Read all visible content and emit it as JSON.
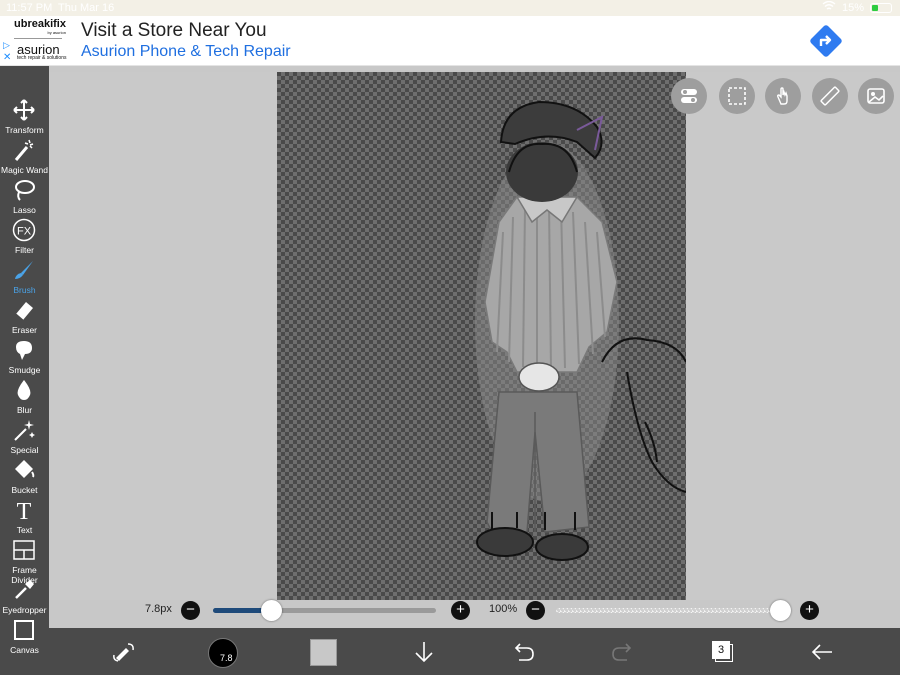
{
  "status": {
    "time": "11:57 PM",
    "date": "Thu Mar 16",
    "battery": "15%"
  },
  "ad": {
    "brand_primary": "ubreakifix",
    "brand_primary_sub": "by asurion",
    "brand_secondary": "asurion",
    "brand_secondary_sub": "tech repair & solutions",
    "headline": "Visit a Store Near You",
    "subline": "Asurion Phone & Tech Repair",
    "icon": "directions-icon",
    "color": "#1f6fe0"
  },
  "tools": [
    {
      "label": "Transform",
      "icon": "move-arrows-icon"
    },
    {
      "label": "Magic Wand",
      "icon": "magic-wand-icon"
    },
    {
      "label": "Lasso",
      "icon": "lasso-icon"
    },
    {
      "label": "Filter",
      "icon": "fx-icon"
    },
    {
      "label": "Brush",
      "icon": "brush-icon",
      "active": true
    },
    {
      "label": "Eraser",
      "icon": "eraser-icon"
    },
    {
      "label": "Smudge",
      "icon": "smudge-icon"
    },
    {
      "label": "Blur",
      "icon": "drop-icon"
    },
    {
      "label": "Special",
      "icon": "sparkle-wand-icon"
    },
    {
      "label": "Bucket",
      "icon": "bucket-icon"
    },
    {
      "label": "Text",
      "icon": "text-icon"
    },
    {
      "label": "Frame Divider",
      "icon": "frame-divider-icon"
    },
    {
      "label": "Eyedropper",
      "icon": "eyedropper-icon"
    },
    {
      "label": "Canvas",
      "icon": "canvas-icon"
    }
  ],
  "filter_glyph": "FX",
  "text_glyph": "T",
  "brush_size": {
    "label": "7.8px",
    "value": 7.8,
    "fraction": 0.26
  },
  "opacity": {
    "label": "100%",
    "fraction": 1.0
  },
  "brush_preview_label": "7.8",
  "layers_count": "3",
  "colors": {
    "accent": "#4aa3e8",
    "slider_fill": "#1e4a7a",
    "toolbar": "#4a4a4a"
  }
}
